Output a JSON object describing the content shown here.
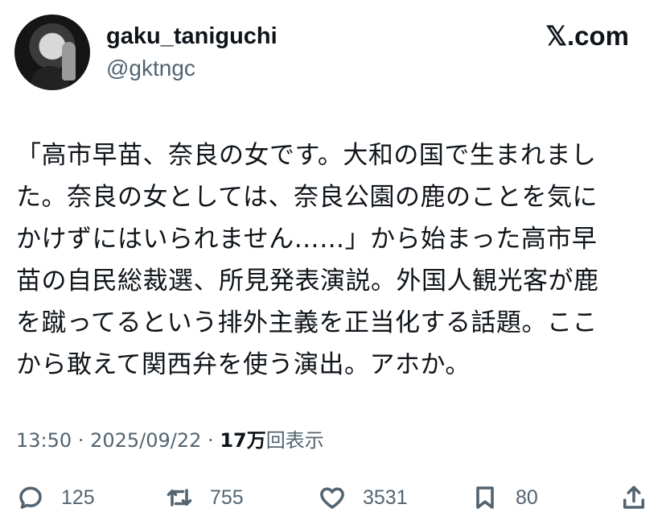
{
  "author": {
    "display_name": "gaku_taniguchi",
    "handle": "@gktngc"
  },
  "brand": "𝕏.com",
  "tweet": {
    "lines": [
      "「高市早苗、奈良の女です。大和の国で生まれまし",
      "た。奈良の女としては、奈良公園の鹿のことを気に",
      "かけずにはいられません……」から始まった高市早",
      "苗の自民総裁選、所見発表演説。外国人観光客が鹿",
      "を蹴ってるという排外主義を正当化する話題。ここ",
      "から敢えて関西弁を使う演出。アホか。"
    ]
  },
  "meta": {
    "time": "13:50",
    "separator": "·",
    "date": "2025/09/22",
    "views_count": "17万",
    "views_label": "回表示"
  },
  "actions": {
    "replies": "125",
    "reposts": "755",
    "likes": "3531",
    "bookmarks": "80"
  }
}
